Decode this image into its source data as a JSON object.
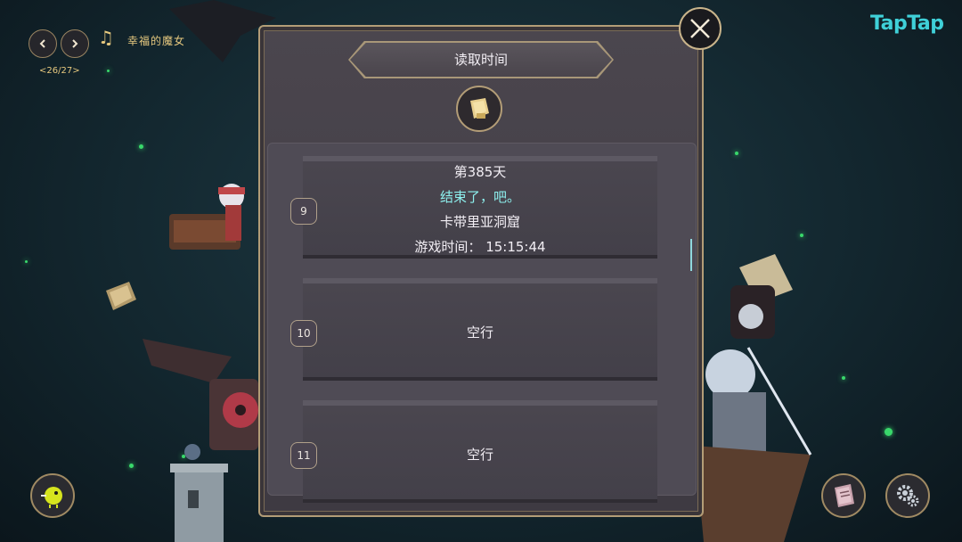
{
  "music": {
    "song_title": "幸福的魔女",
    "track_counter": "<26/27>",
    "prev_icon": "chevron-left-icon",
    "next_icon": "chevron-right-icon",
    "note_icon": "music-note-icon"
  },
  "brand": {
    "logo_text": "TapTap",
    "color": "#3fd0d8"
  },
  "dialog": {
    "title": "读取时间",
    "emblem_icon": "scroll-icon",
    "close_icon": "close-icon"
  },
  "slots": [
    {
      "number": "9",
      "day": "第385天",
      "chapter": "结束了，吧。",
      "location": "卡带里亚洞窟",
      "playtime": "游戏时间：  15:15:44"
    },
    {
      "number": "10",
      "status": "空行"
    },
    {
      "number": "11",
      "status": "空行"
    }
  ],
  "bottom_buttons": {
    "left_icon": "bird-character-icon",
    "book_icon": "book-icon",
    "settings_icon": "gear-icon"
  },
  "colors": {
    "accent_gold": "#e7c97f",
    "highlight_text": "#8df0ee",
    "firefly": "#39d86b"
  }
}
